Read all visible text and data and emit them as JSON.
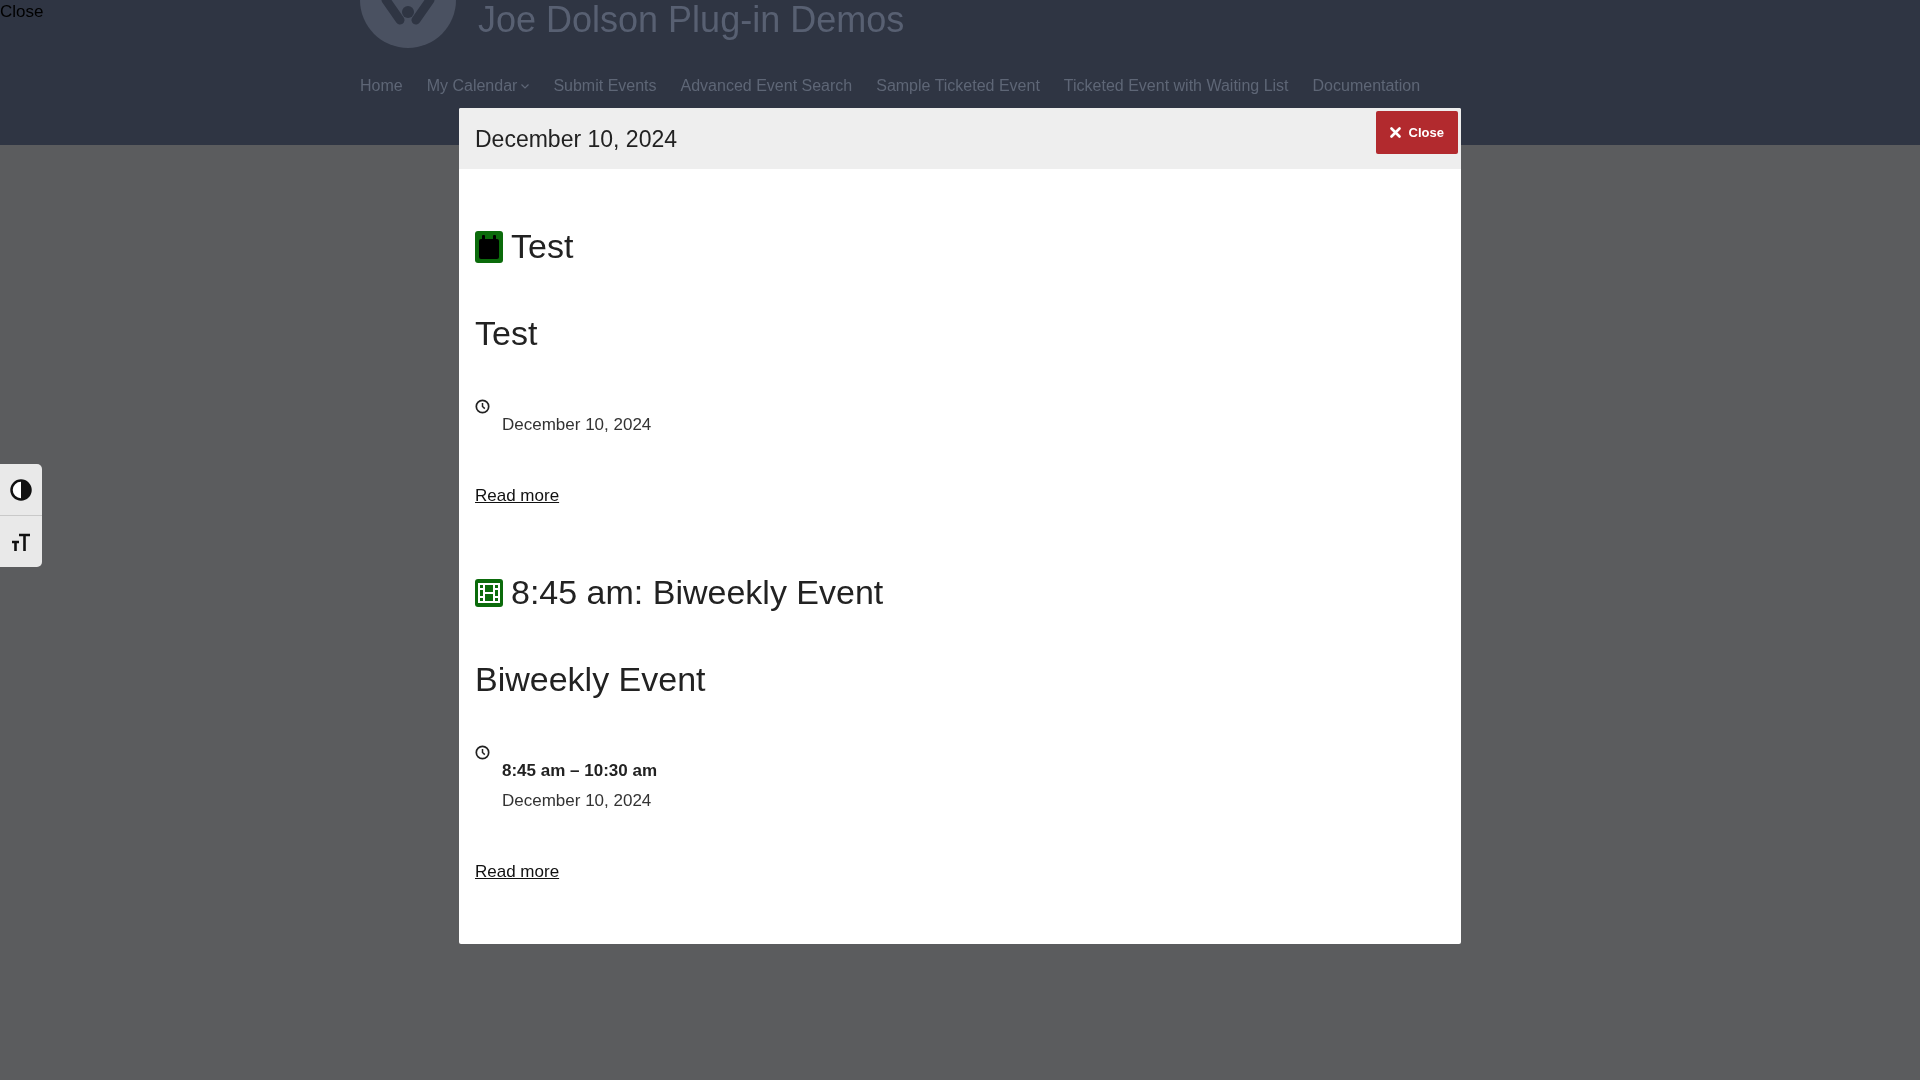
{
  "overlay": {
    "close_link": "Close"
  },
  "header": {
    "site_title": "Joe Dolson Plug-in Demos",
    "nav": [
      {
        "label": "Home",
        "dropdown": false
      },
      {
        "label": "My Calendar",
        "dropdown": true
      },
      {
        "label": "Submit Events",
        "dropdown": false
      },
      {
        "label": "Advanced Event Search",
        "dropdown": false
      },
      {
        "label": "Sample Ticketed Event",
        "dropdown": false
      },
      {
        "label": "Ticketed Event with Waiting List",
        "dropdown": false
      },
      {
        "label": "Documentation",
        "dropdown": false
      }
    ]
  },
  "modal": {
    "title": "December 10, 2024",
    "close_button": "Close",
    "events": [
      {
        "kind": "all-day",
        "heading": "Test",
        "title": "Test",
        "date": "December 10, 2024",
        "link": "Read more"
      },
      {
        "kind": "timed",
        "heading": "8:45 am: Biweekly Event",
        "title": "Biweekly Event",
        "time": "8:45 am – 10:30 am",
        "date": "December 10, 2024",
        "link": "Read more"
      }
    ]
  }
}
